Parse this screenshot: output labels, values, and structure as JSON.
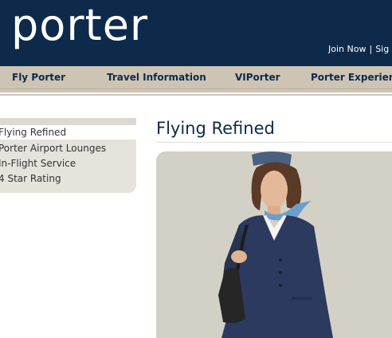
{
  "brand": {
    "logo_text": "porter"
  },
  "util": {
    "join": "Join Now",
    "separator": "|",
    "sign": "Sig"
  },
  "nav": {
    "items": [
      "Fly Porter",
      "Travel Information",
      "VIPorter",
      "Porter Experience"
    ]
  },
  "sidebar": {
    "items": [
      "Flying Refined",
      "Porter Airport Lounges",
      "In-Flight Service",
      "4 Star Rating"
    ],
    "active_index": 0
  },
  "main": {
    "title": "Flying Refined"
  },
  "colors": {
    "header_bg": "#0d2a4a",
    "nav_bg": "#cdc4b4",
    "sidebar_bg": "#e6e2dc",
    "title": "#0d2a4a"
  }
}
